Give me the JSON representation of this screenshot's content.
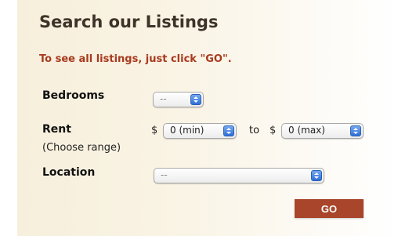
{
  "form": {
    "title": "Search our Listings",
    "note": "To see all listings, just click \"GO\".",
    "bedrooms": {
      "label": "Bedrooms",
      "value": "--"
    },
    "rent": {
      "label": "Rent",
      "sublabel": "(Choose range)",
      "currency": "$",
      "min_value": "0 (min)",
      "to_text": "to",
      "max_value": "0 (max)"
    },
    "location": {
      "label": "Location",
      "value": "--"
    },
    "submit_label": "GO"
  },
  "colors": {
    "accent": "#a8452a",
    "note_text": "#a83a1e",
    "select_arrow": "#2f6fd6"
  }
}
